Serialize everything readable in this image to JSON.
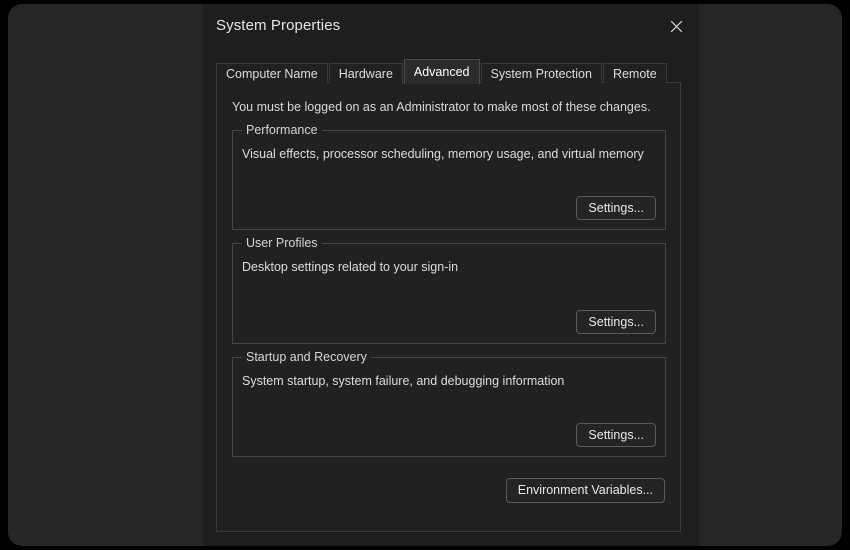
{
  "window": {
    "title": "System Properties",
    "close_icon": "close-icon"
  },
  "tabs": [
    {
      "label": "Computer Name",
      "selected": false
    },
    {
      "label": "Hardware",
      "selected": false
    },
    {
      "label": "Advanced",
      "selected": true
    },
    {
      "label": "System Protection",
      "selected": false
    },
    {
      "label": "Remote",
      "selected": false
    }
  ],
  "content": {
    "admin_notice": "You must be logged on as an Administrator to make most of these changes.",
    "groups": [
      {
        "legend": "Performance",
        "description": "Visual effects, processor scheduling, memory usage, and virtual memory",
        "button": "Settings..."
      },
      {
        "legend": "User Profiles",
        "description": "Desktop settings related to your sign-in",
        "button": "Settings..."
      },
      {
        "legend": "Startup and Recovery",
        "description": "System startup, system failure, and debugging information",
        "button": "Settings..."
      }
    ],
    "environment_variables_button": "Environment Variables..."
  },
  "colors": {
    "desktop": "#262626",
    "dialog_background": "#1e1e1e",
    "panel_background": "#212121",
    "selected_tab_background": "#2b2b2b",
    "border": "#3a3a3a",
    "group_border": "#454545",
    "button_border": "#5a5a5a",
    "text": "#dcdcdc",
    "title_text": "#e6e6e6"
  }
}
